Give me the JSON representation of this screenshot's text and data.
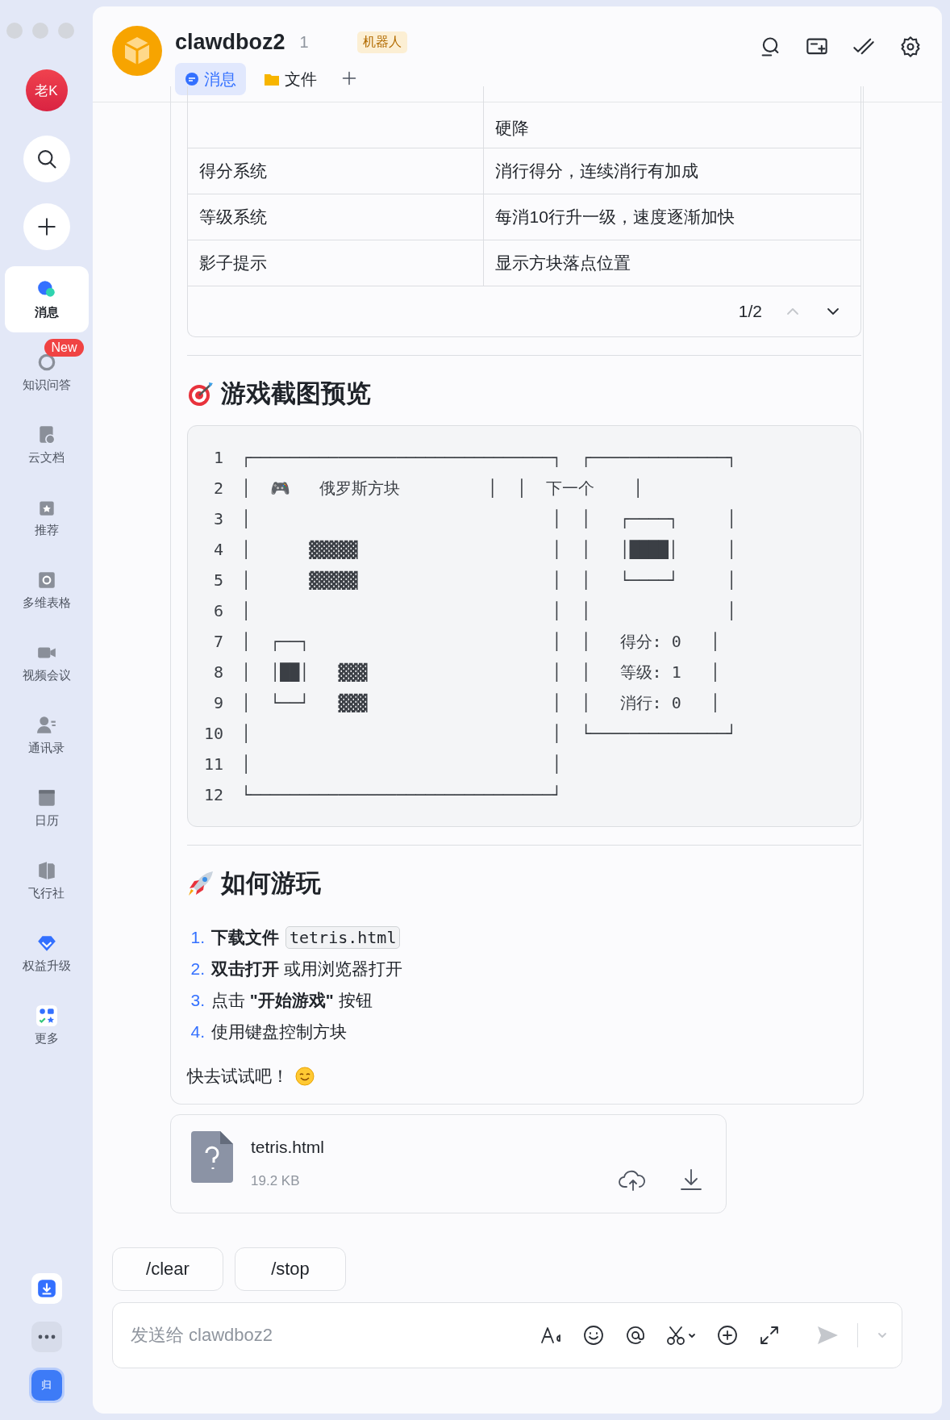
{
  "sidebar": {
    "avatar": "老K",
    "items": [
      {
        "label": "消息",
        "selected": true
      },
      {
        "label": "知识问答",
        "selected": false,
        "badge": "New"
      },
      {
        "label": "云文档",
        "selected": false
      },
      {
        "label": "推荐",
        "selected": false
      },
      {
        "label": "多维表格",
        "selected": false
      },
      {
        "label": "视频会议",
        "selected": false
      },
      {
        "label": "通讯录",
        "selected": false
      },
      {
        "label": "日历",
        "selected": false
      },
      {
        "label": "飞行社",
        "selected": false
      },
      {
        "label": "权益升级",
        "selected": false
      },
      {
        "label": "更多",
        "selected": false
      }
    ],
    "bottom_badge": "归"
  },
  "header": {
    "title": "clawdboz2",
    "count": "1",
    "tag": "机器人",
    "tabs": [
      {
        "label": "消息",
        "selected": true
      },
      {
        "label": "文件",
        "selected": false
      }
    ]
  },
  "table": {
    "rows": [
      {
        "value": "硬降"
      },
      {
        "label": "得分系统",
        "value": "消行得分，连续消行有加成"
      },
      {
        "label": "等级系统",
        "value": "每消10行升一级，速度逐渐加快"
      },
      {
        "label": "影子提示",
        "value": "显示方块落点位置"
      }
    ],
    "pager": "1/2"
  },
  "preview": {
    "heading": "游戏截图预览",
    "line_numbers": [
      "1",
      "2",
      "3",
      "4",
      "5",
      "6",
      "7",
      "8",
      "9",
      "10",
      "11",
      "12"
    ],
    "lines": [
      "┌───────────────────────────────┐  ┌──────────────┐",
      "│  🎮   俄罗斯方块         │  │  下一个    │",
      "│                               │  │   ┌────┐     │",
      "│      ▓▓▓▓▓                    │  │   │████│     │",
      "│      ▓▓▓▓▓                    │  │   └────┘     │",
      "│                               │  │              │",
      "│  ┌──┐                         │  │   得分: 0   │",
      "│  │██│   ▓▓▓                   │  │   等级: 1   │",
      "│  └──┘   ▓▓▓                   │  │   消行: 0   │",
      "│                               │  └──────────────┘",
      "│                               │",
      "└───────────────────────────────┘"
    ]
  },
  "howto": {
    "heading": "如何游玩",
    "steps": [
      {
        "number": "1.",
        "text": "**下载文件**",
        "code": "tetris.html"
      },
      {
        "number": "2.",
        "text": "**双击打开** 或用浏览器打开"
      },
      {
        "number": "3.",
        "text": "点击 **\"开始游戏\"** 按钮"
      },
      {
        "number": "4.",
        "text": "使用键盘控制方块"
      }
    ],
    "closing": "快去试试吧！"
  },
  "file": {
    "name": "tetris.html",
    "size": "19.2 KB"
  },
  "quick_commands": [
    "/clear",
    "/stop"
  ],
  "composer": {
    "placeholder": "发送给 clawdboz2"
  }
}
